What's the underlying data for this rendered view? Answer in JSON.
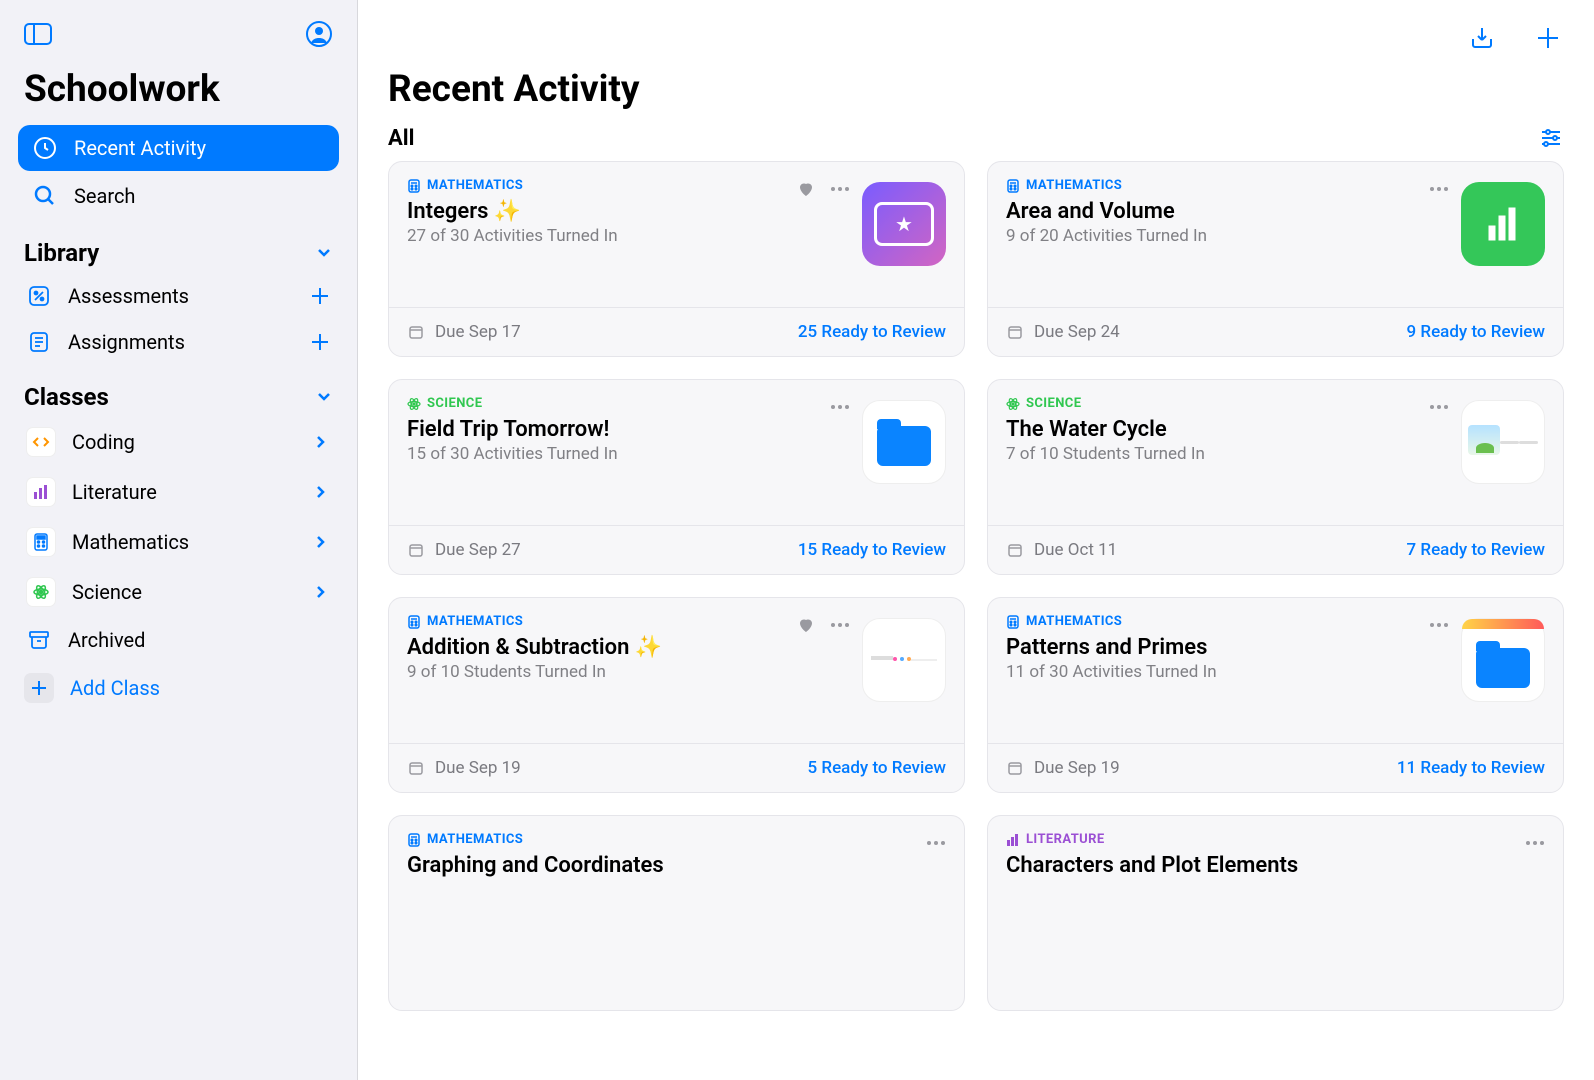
{
  "app": {
    "title": "Schoolwork"
  },
  "sidebar": {
    "nav": {
      "recent": "Recent Activity",
      "search": "Search"
    },
    "library": {
      "header": "Library",
      "assessments": "Assessments",
      "assignments": "Assignments"
    },
    "classes": {
      "header": "Classes",
      "items": [
        {
          "label": "Coding",
          "color": "#ff9500",
          "icon": "code"
        },
        {
          "label": "Literature",
          "color": "#9b4fd4",
          "icon": "bars"
        },
        {
          "label": "Mathematics",
          "color": "#007aff",
          "icon": "calc"
        },
        {
          "label": "Science",
          "color": "#30c750",
          "icon": "atom"
        }
      ],
      "archived": "Archived",
      "add": "Add Class"
    }
  },
  "main": {
    "title": "Recent Activity",
    "filter": "All"
  },
  "cards": [
    {
      "subject": "MATHEMATICS",
      "subjectClass": "subj-math",
      "title": "Integers ✨",
      "subtitle": "27 of 30 Activities Turned In",
      "due": "Due Sep 17",
      "ready": "25 Ready to Review",
      "thumb": "purple",
      "favorited": true
    },
    {
      "subject": "MATHEMATICS",
      "subjectClass": "subj-math",
      "title": "Area and Volume",
      "subtitle": "9 of 20 Activities Turned In",
      "due": "Due Sep 24",
      "ready": "9 Ready to Review",
      "thumb": "green",
      "favorited": false
    },
    {
      "subject": "SCIENCE",
      "subjectClass": "subj-science",
      "title": "Field Trip Tomorrow!",
      "subtitle": "15 of 30 Activities Turned In",
      "due": "Due Sep 27",
      "ready": "15 Ready to Review",
      "thumb": "files",
      "favorited": false
    },
    {
      "subject": "SCIENCE",
      "subjectClass": "subj-science",
      "title": "The Water Cycle",
      "subtitle": "7 of 10 Students Turned In",
      "due": "Due Oct 11",
      "ready": "7 Ready to Review",
      "thumb": "watercycle",
      "favorited": false
    },
    {
      "subject": "MATHEMATICS",
      "subjectClass": "subj-math",
      "title": "Addition & Subtraction ✨",
      "subtitle": "9 of 10 Students Turned In",
      "due": "Due Sep 19",
      "ready": "5 Ready to Review",
      "thumb": "doc",
      "favorited": true
    },
    {
      "subject": "MATHEMATICS",
      "subjectClass": "subj-math",
      "title": "Patterns and Primes",
      "subtitle": "11 of 30 Activities Turned In",
      "due": "Due Sep 19",
      "ready": "11 Ready to Review",
      "thumb": "yellowfiles",
      "favorited": false
    },
    {
      "subject": "MATHEMATICS",
      "subjectClass": "subj-math",
      "title": "Graphing and Coordinates",
      "subtitle": "",
      "due": "",
      "ready": "",
      "thumb": "none",
      "favorited": false
    },
    {
      "subject": "LITERATURE",
      "subjectClass": "subj-literature",
      "title": "Characters and Plot Elements",
      "subtitle": "",
      "due": "",
      "ready": "",
      "thumb": "none",
      "favorited": false
    }
  ]
}
